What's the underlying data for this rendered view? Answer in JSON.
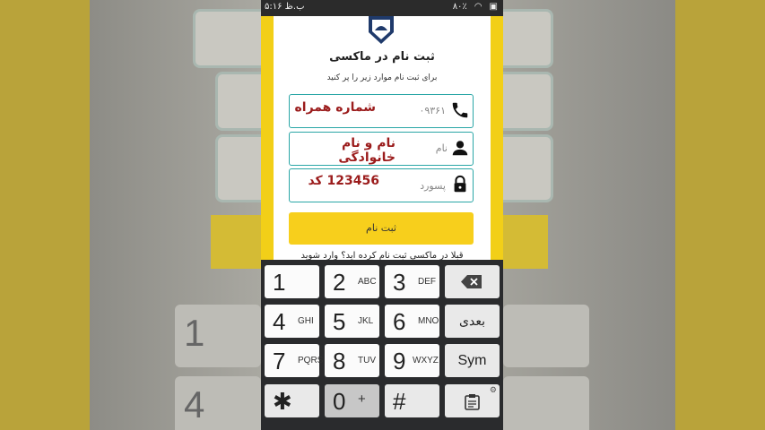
{
  "status_bar": {
    "time": "۵:۱۶ ب.ظ",
    "battery": "۸۰٪"
  },
  "app": {
    "title": "ثبت نام در ماکسی",
    "subtitle": "برای ثبت نام موارد زیر را پر کنید",
    "logo_icon": "maxi-logo-icon"
  },
  "fields": [
    {
      "placeholder": "۰۹۳۶۱",
      "overlay": "شماره همراه",
      "icon": "phone-icon"
    },
    {
      "placeholder": "نام",
      "overlay": "نام و نام خانوادگی",
      "icon": "user-icon"
    },
    {
      "placeholder": "پسورد",
      "overlay": "123456  کد",
      "icon": "lock-icon"
    }
  ],
  "register_button": "ثبت نام",
  "partial_text": "قبلا در ماکسی ثبت نام کرده اید؟ وارد شوید",
  "keyboard": {
    "rows": [
      [
        {
          "num": "1",
          "let": ""
        },
        {
          "num": "2",
          "let": "ABC"
        },
        {
          "num": "3",
          "let": "DEF"
        },
        {
          "label": "⌫",
          "name": "backspace-key"
        }
      ],
      [
        {
          "num": "4",
          "let": "GHI"
        },
        {
          "num": "5",
          "let": "JKL"
        },
        {
          "num": "6",
          "let": "MNO"
        },
        {
          "label": "بعدی",
          "name": "next-key"
        }
      ],
      [
        {
          "num": "7",
          "let": "PQRS"
        },
        {
          "num": "8",
          "let": "TUV"
        },
        {
          "num": "9",
          "let": "WXYZ"
        },
        {
          "label": "Sym",
          "name": "sym-key"
        }
      ],
      [
        {
          "num": "✱",
          "let": ""
        },
        {
          "num": "0",
          "let": "+"
        },
        {
          "num": "#",
          "let": ""
        },
        {
          "label": "📋",
          "name": "clipboard-key"
        }
      ]
    ]
  },
  "colors": {
    "accent_yellow": "#f7cf1c",
    "field_border": "#2aa6a6",
    "overlay_text": "#9b1c1c"
  }
}
